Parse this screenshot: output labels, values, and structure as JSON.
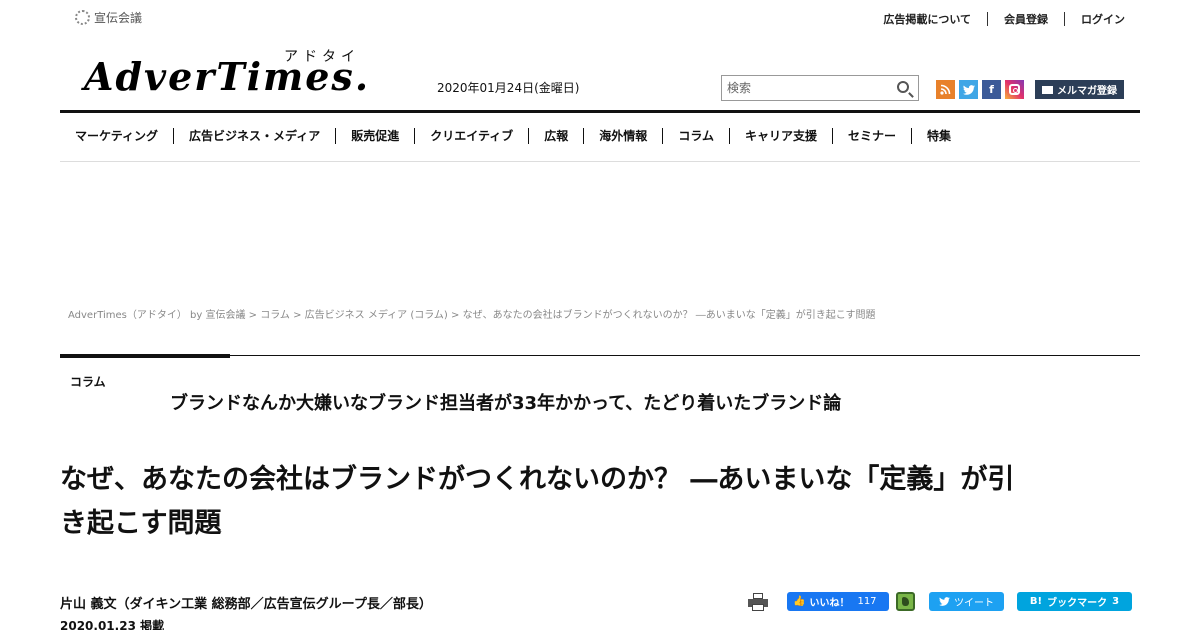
{
  "header": {
    "sender_name": "宣伝会議",
    "util_links": [
      "広告掲載について",
      "会員登録",
      "ログイン"
    ],
    "logo_word": "AdverTimes.",
    "logo_kana": "アドタイ",
    "date": "2020年01月24日(金曜日)",
    "search_placeholder": "検索",
    "mail_button": "メルマガ登録",
    "social_icons": [
      "rss-icon",
      "twitter-icon",
      "facebook-icon",
      "instagram-icon"
    ],
    "colors": {
      "rss": "#e8812a",
      "twitter": "#3fa6e6",
      "facebook": "#3b5a98",
      "mail_button": "#2c3e57"
    }
  },
  "nav": {
    "items": [
      "マーケティング",
      "広告ビジネス・メディア",
      "販売促進",
      "クリエイティブ",
      "広報",
      "海外情報",
      "コラム",
      "キャリア支援",
      "セミナー",
      "特集"
    ]
  },
  "breadcrumb": "AdverTimes（アドタイ） by 宣伝会議 > コラム > 広告ビジネス メディア (コラム) > なぜ、あなたの会社はブランドがつくれないのか？ ―あいまいな「定義」が引き起こす問題",
  "article": {
    "category": "コラム",
    "series_title": "ブランドなんか大嫌いなブランド担当者が33年かかって、たどり着いたブランド論",
    "title": "なぜ、あなたの会社はブランドがつくれないのか？ ―あいまいな「定義」が引き起こす問題",
    "author": "片山 義文（ダイキン工業 総務部／広告宣伝グループ長／部長）",
    "posted": "2020.01.23 掲載"
  },
  "share": {
    "fb_like_label": "いいね！",
    "fb_like_count": "117",
    "tweet_label": "ツイート",
    "hatena_label": "ブックマーク",
    "hatena_mark": "B!",
    "hatena_count": "3",
    "colors": {
      "facebook": "#1877f2",
      "twitter": "#1da1f2",
      "hatena": "#00a4de"
    }
  }
}
